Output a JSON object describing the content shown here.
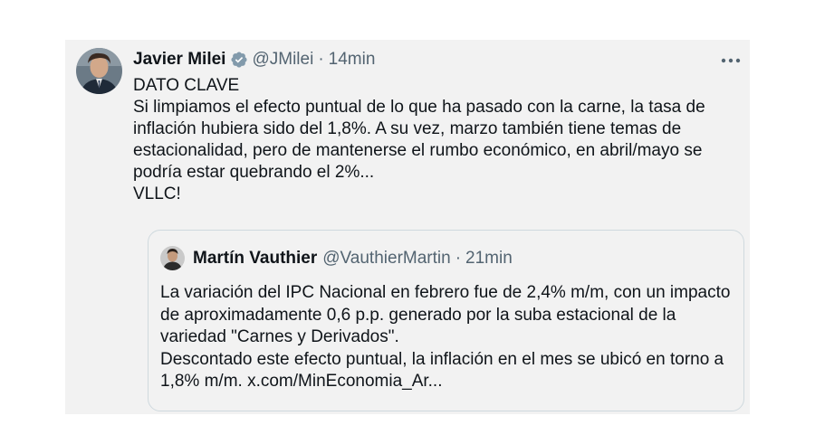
{
  "tweet": {
    "author_name": "Javier Milei",
    "handle": "@JMilei",
    "separator": "·",
    "time": "14min",
    "lines": [
      "DATO CLAVE",
      "Si limpiamos el efecto puntual de lo que ha pasado con la carne, la tasa de inflación hubiera sido del 1,8%. A su vez, marzo también tiene temas de estacionalidad, pero de mantenerse el rumbo económico, en abril/mayo se podría estar quebrando el 2%...",
      "VLLC!"
    ]
  },
  "quoted_tweet": {
    "author_name": "Martín Vauthier",
    "handle": "@VauthierMartin",
    "separator": "·",
    "time": "21min",
    "lines": [
      "La variación del IPC Nacional en febrero fue de 2,4% m/m, con un impacto de aproximadamente 0,6 p.p. generado por la suba estacional de la variedad \"Carnes y Derivados\".",
      "Descontado este efecto puntual, la inflación en el mes se ubicó en torno a 1,8% m/m. x.com/MinEconomia_Ar..."
    ]
  },
  "icons": {
    "verified": "verified-badge-icon",
    "more": "more-options-icon"
  },
  "colors": {
    "card_background": "#f2f2f2",
    "text": "#0f1419",
    "secondary_text": "#536471",
    "verified_badge": "#829aab",
    "border": "#cfd9de"
  }
}
